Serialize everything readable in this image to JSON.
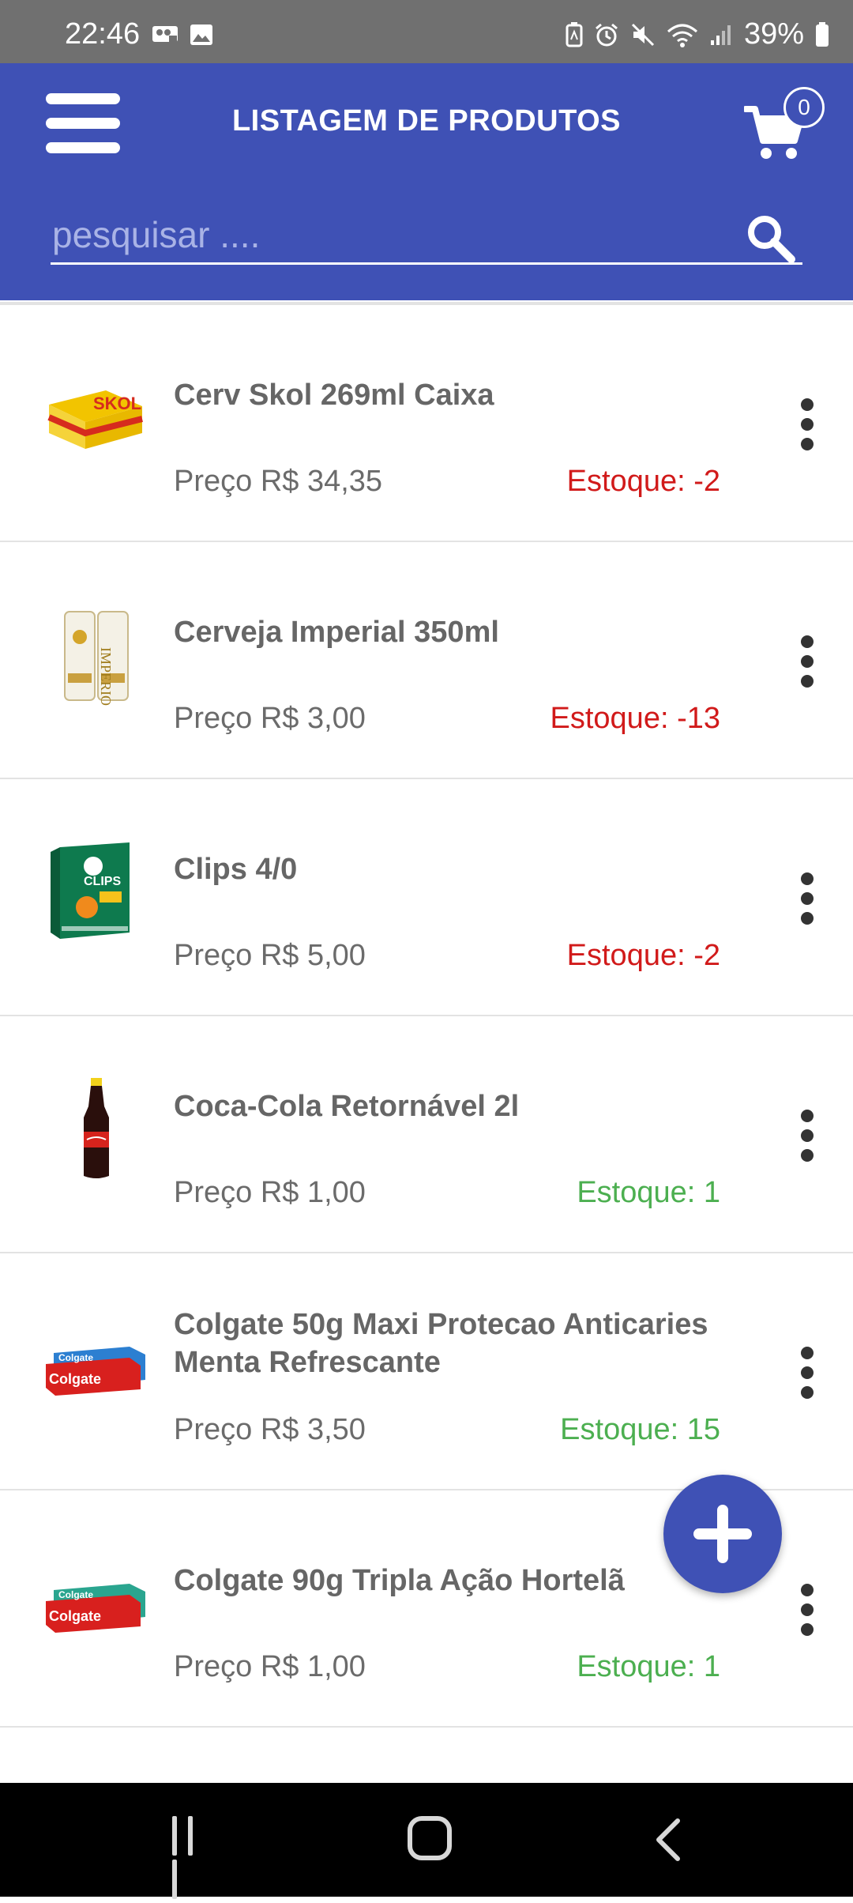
{
  "status_bar": {
    "time": "22:46",
    "battery": "39%",
    "icons": [
      "voicemail-icon",
      "image-icon",
      "battery-saver-icon",
      "alarm-icon",
      "mute-icon",
      "wifi-icon",
      "signal-icon",
      "battery-icon"
    ]
  },
  "app_bar": {
    "title": "LISTAGEM DE PRODUTOS",
    "cart_count": "0",
    "menu_icon": "menu-icon",
    "cart_icon": "cart-icon"
  },
  "search": {
    "placeholder": "pesquisar ....",
    "value": "",
    "icon": "search-icon"
  },
  "products": [
    {
      "name": "Cerv Skol 269ml Caixa",
      "price": "Preço R$ 34,35",
      "stock": "Estoque: -2",
      "stock_status": "negative",
      "thumb": "beer-box-image"
    },
    {
      "name": "Cerveja Imperial 350ml",
      "price": "Preço R$ 3,00",
      "stock": "Estoque: -13",
      "stock_status": "negative",
      "thumb": "beer-cans-image"
    },
    {
      "name": "Clips 4/0",
      "price": "Preço R$ 5,00",
      "stock": "Estoque: -2",
      "stock_status": "negative",
      "thumb": "clips-box-image"
    },
    {
      "name": "Coca-Cola Retornável 2l",
      "price": "Preço R$ 1,00",
      "stock": "Estoque: 1",
      "stock_status": "positive",
      "thumb": "soda-bottle-image"
    },
    {
      "name": "Colgate 50g Maxi Protecao Anticaries Menta Refrescante",
      "price": "Preço R$ 3,50",
      "stock": "Estoque: 15",
      "stock_status": "positive",
      "thumb": "toothpaste-image"
    },
    {
      "name": "Colgate 90g Tripla Ação Hortelã",
      "price": "Preço R$ 1,00",
      "stock": "Estoque: 1",
      "stock_status": "positive",
      "thumb": "toothpaste-image"
    }
  ],
  "colors": {
    "primary": "#3f51b5",
    "stock_negative": "#d11a1a",
    "stock_positive": "#4caf50"
  }
}
